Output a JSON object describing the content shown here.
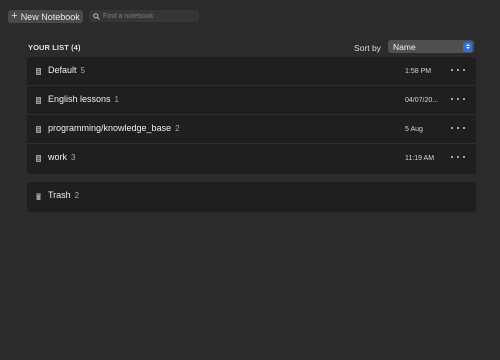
{
  "toolbar": {
    "new_notebook_label": "New Notebook",
    "search_placeholder": "Find a notebook"
  },
  "list": {
    "title": "YOUR LIST (4)",
    "sort_label": "Sort by",
    "sort_value": "Name",
    "accent_color": "#2f6fdc",
    "notebooks": [
      {
        "name": "Default",
        "count": "5",
        "time": "1:58 PM"
      },
      {
        "name": "English lessons",
        "count": "1",
        "time": "04/07/20..."
      },
      {
        "name": "programming/knowledge_base",
        "count": "2",
        "time": "5 Aug"
      },
      {
        "name": "work",
        "count": "3",
        "time": "11:19 AM"
      }
    ]
  },
  "trash": {
    "name": "Trash",
    "count": "2"
  },
  "icons": {
    "notebook": "notebook-icon",
    "trash": "trash-icon",
    "search": "search-icon",
    "plus": "plus-icon",
    "more": "more-options-icon"
  }
}
